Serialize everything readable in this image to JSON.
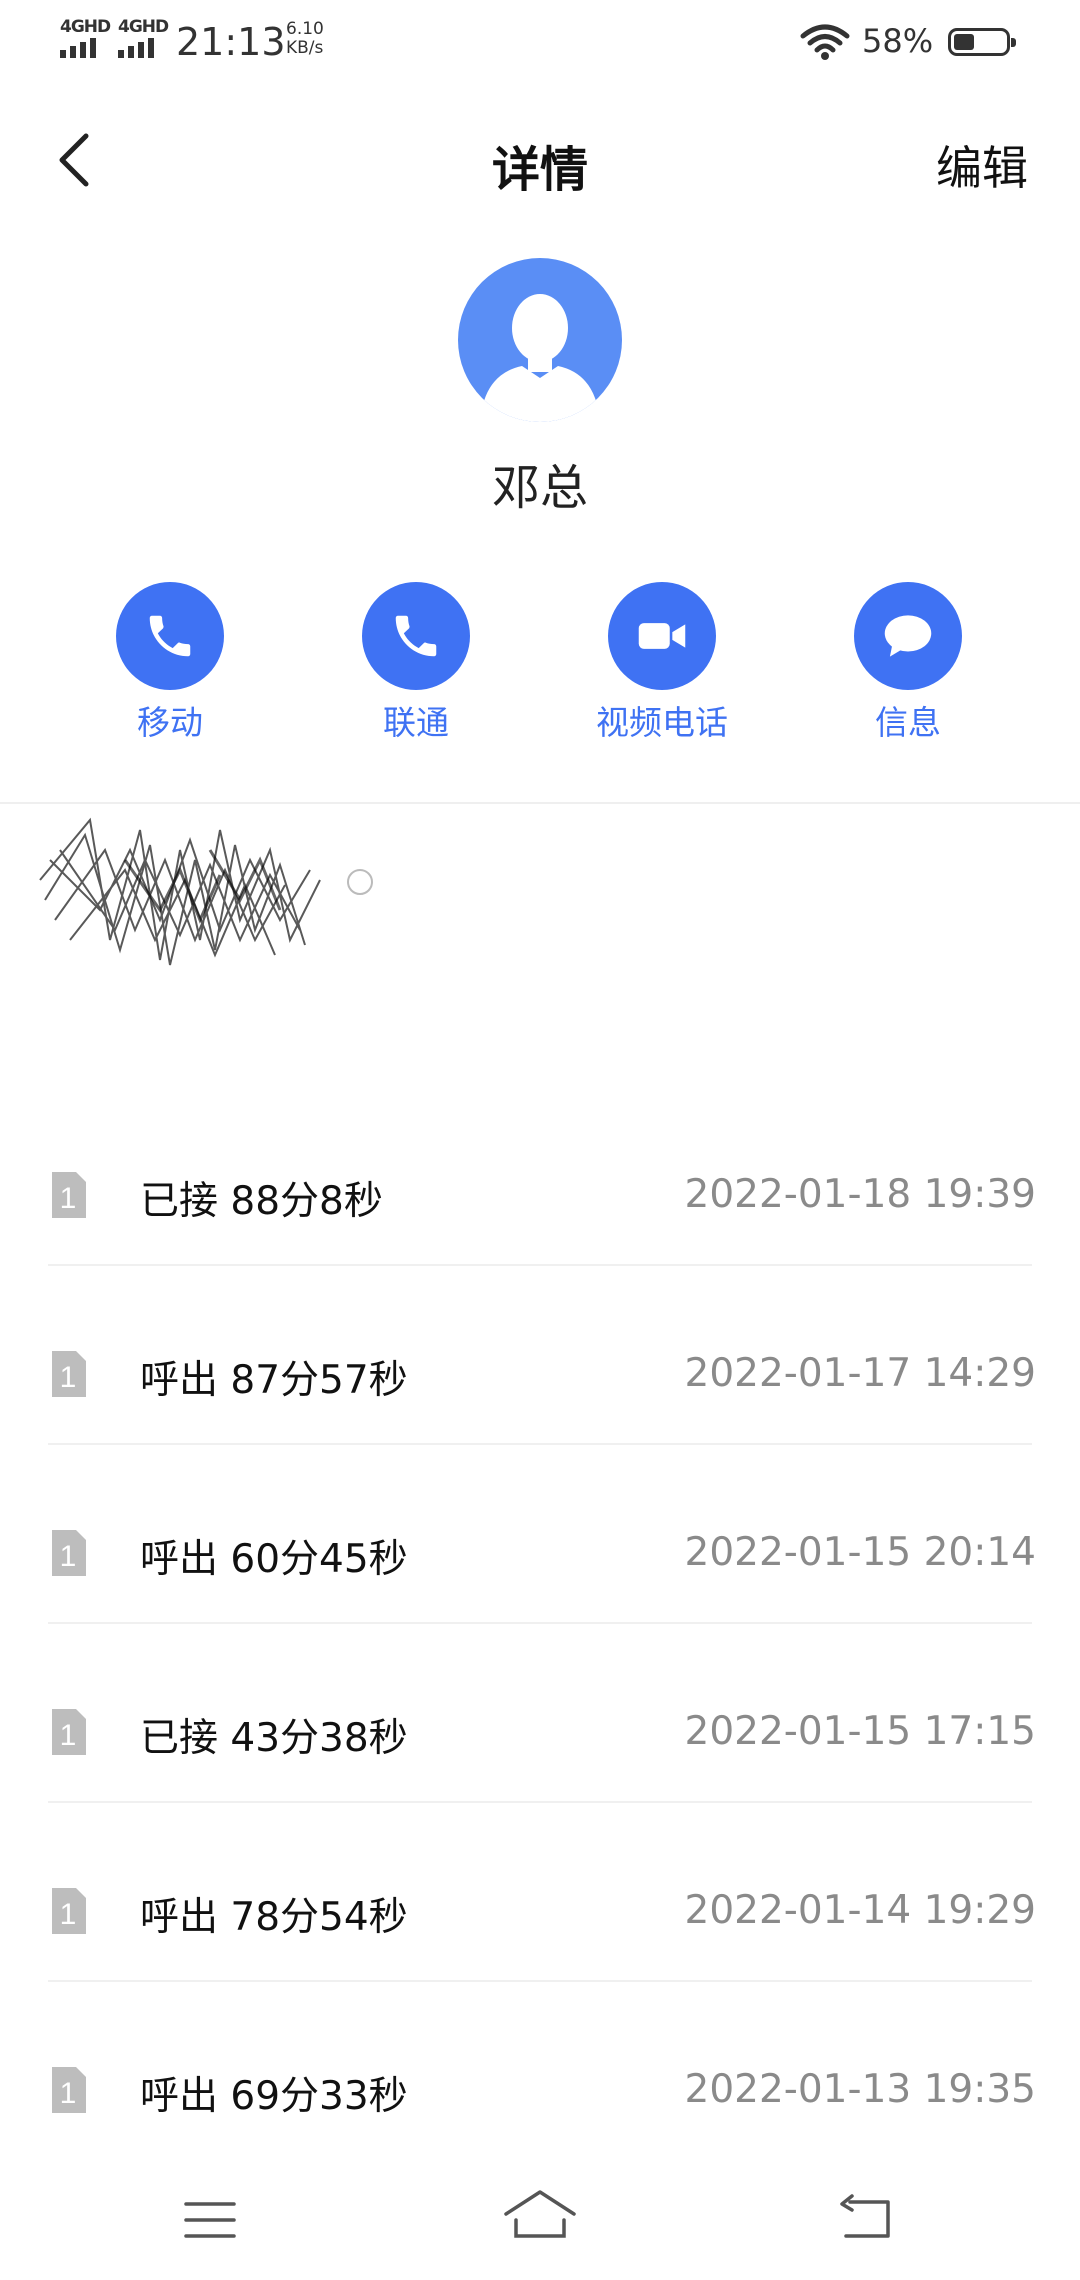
{
  "status_bar": {
    "sim1_label": "4GHD",
    "sim2_label": "4GHD",
    "time": "21:13",
    "speed_value": "6.10",
    "speed_unit": "KB/s",
    "battery_percent": "58%",
    "battery_level": 0.58
  },
  "header": {
    "title": "详情",
    "edit_label": "编辑",
    "back_icon": "chevron-left-icon"
  },
  "contact": {
    "name": "邓总",
    "avatar_icon": "person-avatar-icon"
  },
  "actions": [
    {
      "label": "移动",
      "icon": "phone-icon"
    },
    {
      "label": "联通",
      "icon": "phone-icon"
    },
    {
      "label": "视频电话",
      "icon": "video-camera-icon"
    },
    {
      "label": "信息",
      "icon": "message-bubble-icon"
    }
  ],
  "calls": [
    {
      "sim": "1",
      "text": "已接 88分8秒",
      "time": "2022-01-18 19:39"
    },
    {
      "sim": "1",
      "text": "呼出 87分57秒",
      "time": "2022-01-17 14:29"
    },
    {
      "sim": "1",
      "text": "呼出 60分45秒",
      "time": "2022-01-15 20:14"
    },
    {
      "sim": "1",
      "text": "已接 43分38秒",
      "time": "2022-01-15 17:15"
    },
    {
      "sim": "1",
      "text": "呼出 78分54秒",
      "time": "2022-01-14 19:29"
    },
    {
      "sim": "1",
      "text": "呼出 69分33秒",
      "time": "2022-01-13 19:35"
    }
  ],
  "nav": {
    "menu_icon": "menu-icon",
    "home_icon": "home-icon",
    "back_icon": "back-icon"
  },
  "colors": {
    "accent": "#3f72f3",
    "avatar_bg": "#5a8ef5",
    "secondary_text": "#8a8a8a"
  }
}
